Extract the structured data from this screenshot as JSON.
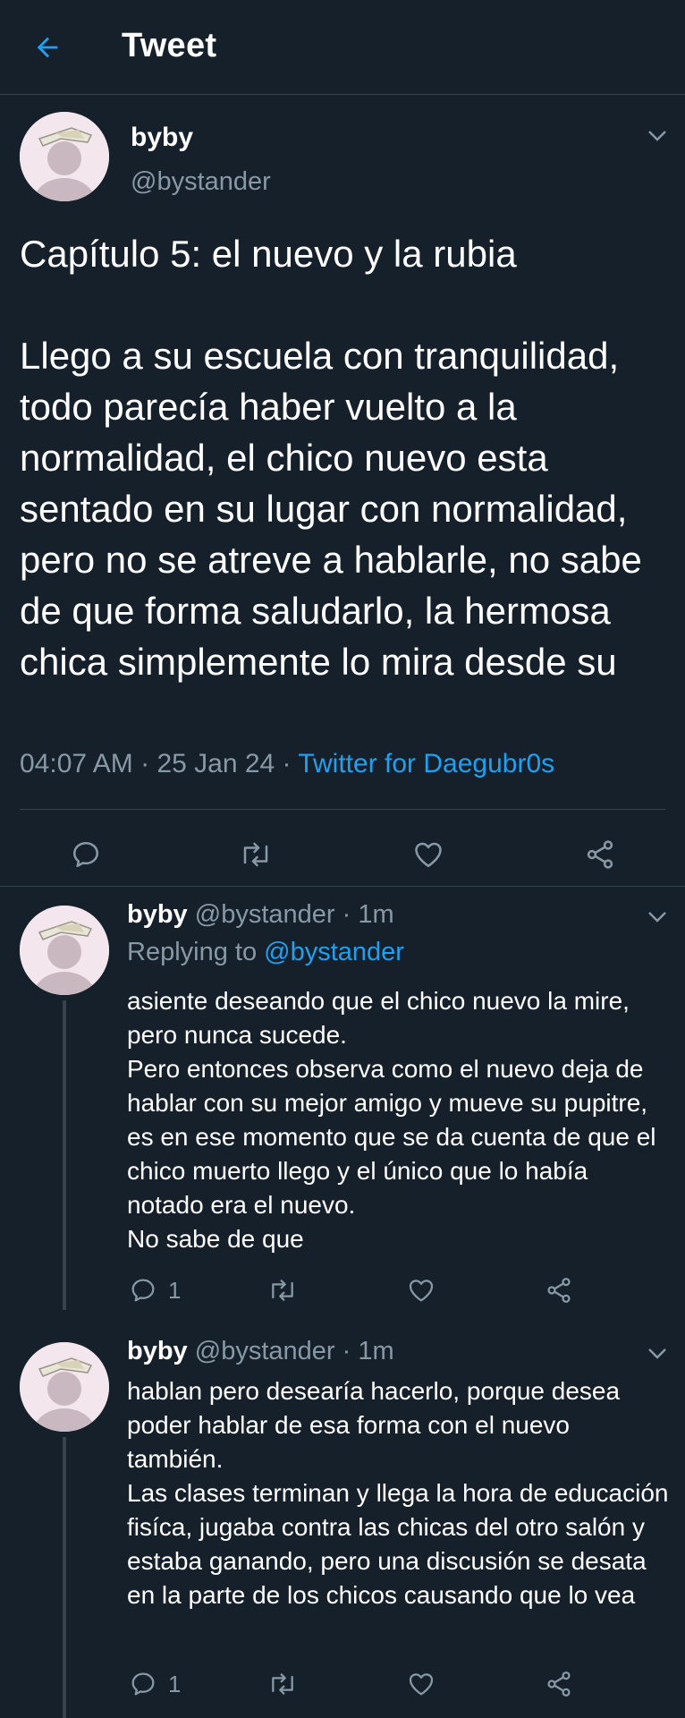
{
  "header": {
    "title": "Tweet"
  },
  "colors": {
    "background": "#15202b",
    "accent": "#1da1f2",
    "muted": "#8899a6",
    "divider": "#38444d"
  },
  "main_tweet": {
    "name": "byby",
    "handle": "@bystander",
    "text": "Capítulo 5: el nuevo y la rubia\n\nLlego a su escuela con tranquilidad, todo parecía haber vuelto a la normalidad, el chico nuevo esta sentado en su lugar con normalidad, pero no se atreve a hablarle, no sabe de que forma saludarlo, la hermosa chica simplemente lo mira desde su",
    "time": "04:07 AM",
    "sep1": " · ",
    "date": "25 Jan 24",
    "sep2": " · ",
    "source": "Twitter for Daegubr0s"
  },
  "replies": [
    {
      "name": "byby",
      "handle": "@bystander",
      "time": " · 1m",
      "replying_prefix": "Replying to ",
      "replying_to": "@bystander",
      "text": "asiente deseando que el chico nuevo la mire, pero nunca sucede.\nPero entonces observa como el nuevo deja de hablar con su mejor amigo y mueve su pupitre, es en ese momento que se da cuenta de que el chico muerto llego y el único que lo había notado era el nuevo.\nNo sabe de que",
      "reply_count": "1"
    },
    {
      "name": "byby",
      "handle": "@bystander",
      "time": " · 1m",
      "text": "hablan pero desearía hacerlo, porque desea poder hablar de esa forma con el nuevo también.\nLas clases terminan y llega la hora de educación fisíca, jugaba contra las chicas del otro salón y estaba ganando, pero una discusión se desata en la parte de los chicos causando que lo vea",
      "reply_count": "1"
    }
  ],
  "icons": [
    "back-arrow-icon",
    "chevron-down-icon",
    "reply-icon",
    "retweet-icon",
    "like-icon",
    "share-icon"
  ]
}
